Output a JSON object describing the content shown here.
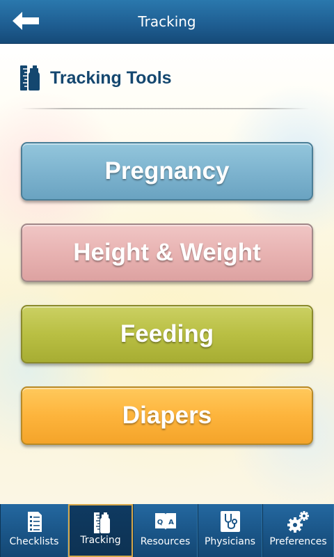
{
  "header": {
    "title": "Tracking",
    "back_icon": "back-arrow-icon"
  },
  "section": {
    "icon": "ruler-bottle-icon",
    "title": "Tracking Tools"
  },
  "buttons": [
    {
      "label": "Pregnancy",
      "color": "#7eb4cf"
    },
    {
      "label": "Height & Weight",
      "color": "#e8b3b2"
    },
    {
      "label": "Feeding",
      "color": "#b9bf43"
    },
    {
      "label": "Diapers",
      "color": "#fdb43c"
    }
  ],
  "tabs": [
    {
      "label": "Checklists",
      "icon": "checklist-icon",
      "active": false
    },
    {
      "label": "Tracking",
      "icon": "ruler-bottle-icon",
      "active": true
    },
    {
      "label": "Resources",
      "icon": "qa-book-icon",
      "active": false
    },
    {
      "label": "Physicians",
      "icon": "stethoscope-icon",
      "active": false
    },
    {
      "label": "Preferences",
      "icon": "gears-icon",
      "active": false
    }
  ],
  "colors": {
    "header": "#1f5f93",
    "accent_text": "#14476f",
    "active_tab_border": "#d6a84a"
  }
}
